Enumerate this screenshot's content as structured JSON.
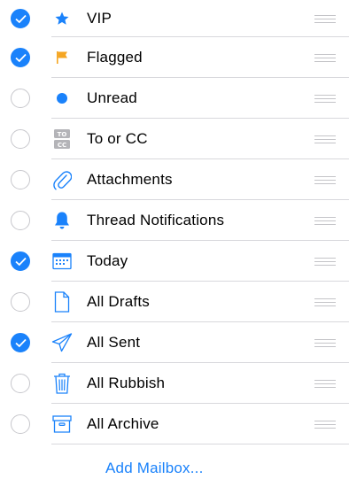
{
  "accent_color": "#1a82fb",
  "flag_color": "#f5a623",
  "mailboxes": [
    {
      "label": "VIP",
      "checked": true,
      "icon": "star-icon"
    },
    {
      "label": "Flagged",
      "checked": true,
      "icon": "flag-icon"
    },
    {
      "label": "Unread",
      "checked": false,
      "icon": "unread-dot-icon"
    },
    {
      "label": "To or CC",
      "checked": false,
      "icon": "to-cc-icon"
    },
    {
      "label": "Attachments",
      "checked": false,
      "icon": "paperclip-icon"
    },
    {
      "label": "Thread Notifications",
      "checked": false,
      "icon": "bell-icon"
    },
    {
      "label": "Today",
      "checked": true,
      "icon": "calendar-icon"
    },
    {
      "label": "All Drafts",
      "checked": false,
      "icon": "document-icon"
    },
    {
      "label": "All Sent",
      "checked": true,
      "icon": "paper-plane-icon"
    },
    {
      "label": "All Rubbish",
      "checked": false,
      "icon": "trash-icon"
    },
    {
      "label": "All Archive",
      "checked": false,
      "icon": "archive-icon"
    }
  ],
  "to_cc_icon_text": {
    "top": "TO",
    "bottom": "CC"
  },
  "add_mailbox_label": "Add Mailbox..."
}
